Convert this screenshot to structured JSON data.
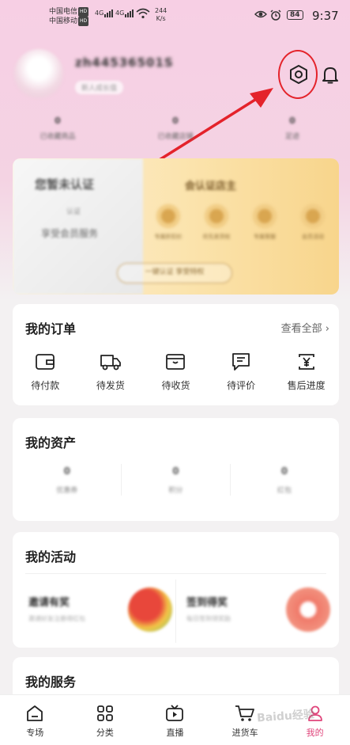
{
  "status_bar": {
    "carrier1": "中国电信",
    "carrier2": "中国移动",
    "hd": "HD",
    "signal1": "4G",
    "signal2": "4G",
    "speed_value": "244",
    "speed_unit": "K/s",
    "battery": "84",
    "time": "9:37"
  },
  "profile": {
    "username": "zh44536501S",
    "tag": "新人成长值"
  },
  "stats": [
    {
      "num": "0",
      "label": "已收藏商品"
    },
    {
      "num": "0",
      "label": "已收藏店铺"
    },
    {
      "num": "0",
      "label": "足迹"
    }
  ],
  "banner": {
    "left_title": "您暂未认证",
    "left_sub": "认证",
    "left_desc": "享受会员服务",
    "right_title": "会认证店主",
    "perks": [
      "专属折扣价",
      "优先发货权",
      "专属客服",
      "会员活动"
    ],
    "button": "一键认证 享受特权"
  },
  "orders": {
    "title": "我的订单",
    "more": "查看全部",
    "items": [
      {
        "label": "待付款",
        "icon": "wallet-icon"
      },
      {
        "label": "待发货",
        "icon": "truck-icon"
      },
      {
        "label": "待收货",
        "icon": "box-icon"
      },
      {
        "label": "待评价",
        "icon": "comment-icon"
      },
      {
        "label": "售后进度",
        "icon": "yen-refund-icon"
      }
    ]
  },
  "assets": {
    "title": "我的资产",
    "cols": [
      {
        "value": "0",
        "label": "优惠券"
      },
      {
        "value": "0",
        "label": "积分"
      },
      {
        "value": "0",
        "label": "红包"
      }
    ]
  },
  "activities": {
    "title": "我的活动",
    "items": [
      {
        "title": "邀请有奖",
        "sub": "邀请好友注册得红包"
      },
      {
        "title": "签到得奖",
        "sub": "每日签到领奖励"
      }
    ]
  },
  "services": {
    "title": "我的服务"
  },
  "tabbar": {
    "tabs": [
      {
        "label": "专场",
        "icon": "home-icon"
      },
      {
        "label": "分类",
        "icon": "grid-icon"
      },
      {
        "label": "直播",
        "icon": "tv-icon"
      },
      {
        "label": "进货车",
        "icon": "cart-icon"
      },
      {
        "label": "我的",
        "icon": "user-icon"
      }
    ],
    "active": "我的"
  },
  "watermark": "Baidu经验",
  "colors": {
    "accent": "#e0457b",
    "annotation": "#e4232b",
    "gold": "#d9a650"
  }
}
